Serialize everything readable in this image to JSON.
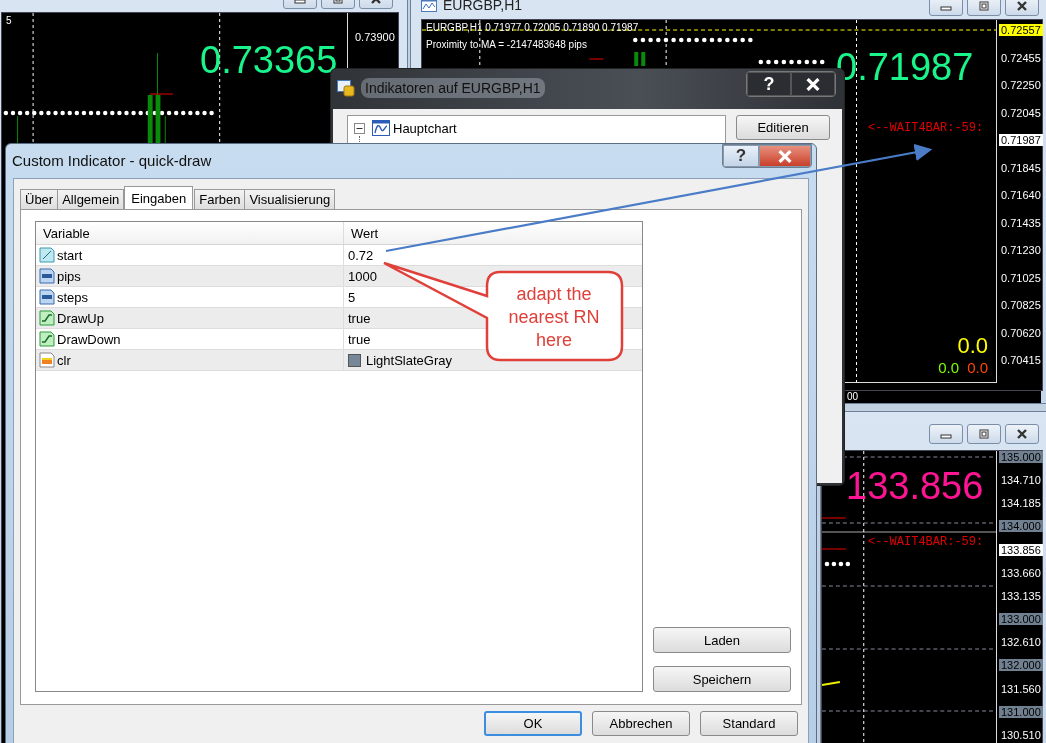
{
  "chart_windows": [
    {
      "info": "5",
      "price": "0.73365",
      "color": "#19f58a",
      "axis_labels": [
        {
          "text": "0.73900",
          "kind": "plain"
        }
      ]
    },
    {
      "title": "EURGBP,H1",
      "info": "EURGBP,H1  0.71977 0.72005 0.71890 0.71987",
      "proximity": "Proximity to MA = -2147483648 pips",
      "price": "0.71987",
      "color": "#19f58a",
      "wait_text": "<--WAIT4BAR:-59:",
      "axis_labels": [
        {
          "text": "0.72557",
          "kind": "alert"
        },
        {
          "text": "0.72455",
          "kind": "plain"
        },
        {
          "text": "0.72250",
          "kind": "plain"
        },
        {
          "text": "0.72045",
          "kind": "plain"
        },
        {
          "text": "0.71987",
          "kind": "current"
        },
        {
          "text": "0.71845",
          "kind": "plain"
        },
        {
          "text": "0.71640",
          "kind": "plain"
        },
        {
          "text": "0.71435",
          "kind": "plain"
        },
        {
          "text": "0.71230",
          "kind": "plain"
        },
        {
          "text": "0.71025",
          "kind": "plain"
        },
        {
          "text": "0.70825",
          "kind": "plain"
        },
        {
          "text": "0.70620",
          "kind": "plain"
        },
        {
          "text": "0.70415",
          "kind": "plain"
        }
      ],
      "totals": [
        {
          "text": "0.0",
          "color": "#ffff00"
        },
        {
          "text": "0.0",
          "color": "#7cfc00"
        },
        {
          "text": "0.0",
          "color": "#ff4500"
        }
      ],
      "time_fragment": "00"
    },
    {
      "price": "133.856",
      "color": "#ff1493",
      "wait_text": "<--WAIT4BAR:-59:",
      "axis_labels": [
        {
          "text": "135.000",
          "kind": "level"
        },
        {
          "text": "134.710",
          "kind": "plain"
        },
        {
          "text": "134.185",
          "kind": "plain"
        },
        {
          "text": "134.000",
          "kind": "level"
        },
        {
          "text": "133.856",
          "kind": "current"
        },
        {
          "text": "133.660",
          "kind": "plain"
        },
        {
          "text": "133.135",
          "kind": "plain"
        },
        {
          "text": "133.000",
          "kind": "level"
        },
        {
          "text": "132.610",
          "kind": "plain"
        },
        {
          "text": "132.000",
          "kind": "level"
        },
        {
          "text": "131.560",
          "kind": "plain"
        },
        {
          "text": "131.000",
          "kind": "level"
        },
        {
          "text": "130.510",
          "kind": "plain"
        }
      ]
    }
  ],
  "indicators_dialog": {
    "title": "Indikatoren auf EURGBP,H1",
    "help": "?",
    "tree": [
      {
        "label": "Hauptchart",
        "expanded": true
      }
    ],
    "edit_button": "Editieren"
  },
  "custom_dialog": {
    "title": "Custom Indicator - quick-draw",
    "help": "?",
    "tabs": [
      {
        "label": "Über",
        "selected": false
      },
      {
        "label": "Allgemein",
        "selected": false
      },
      {
        "label": "Eingaben",
        "selected": true
      },
      {
        "label": "Farben",
        "selected": false
      },
      {
        "label": "Visualisierung",
        "selected": false
      }
    ],
    "table": {
      "columns": [
        "Variable",
        "Wert"
      ],
      "rows": [
        {
          "kind": "double",
          "variable": "start",
          "value": "0.72"
        },
        {
          "kind": "int",
          "variable": "pips",
          "value": "1000"
        },
        {
          "kind": "int",
          "variable": "steps",
          "value": "5"
        },
        {
          "kind": "bool",
          "variable": "DrawUp",
          "value": "true"
        },
        {
          "kind": "bool",
          "variable": "DrawDown",
          "value": "true"
        },
        {
          "kind": "color",
          "variable": "clr",
          "value": "LightSlateGray",
          "color": "#778899"
        }
      ]
    },
    "side_buttons": [
      "Laden",
      "Speichern"
    ],
    "buttons": [
      {
        "label": "OK",
        "default": true
      },
      {
        "label": "Abbrechen",
        "default": false
      },
      {
        "label": "Standard",
        "default": false
      }
    ]
  },
  "callout": {
    "text": "adapt the nearest RN here"
  }
}
